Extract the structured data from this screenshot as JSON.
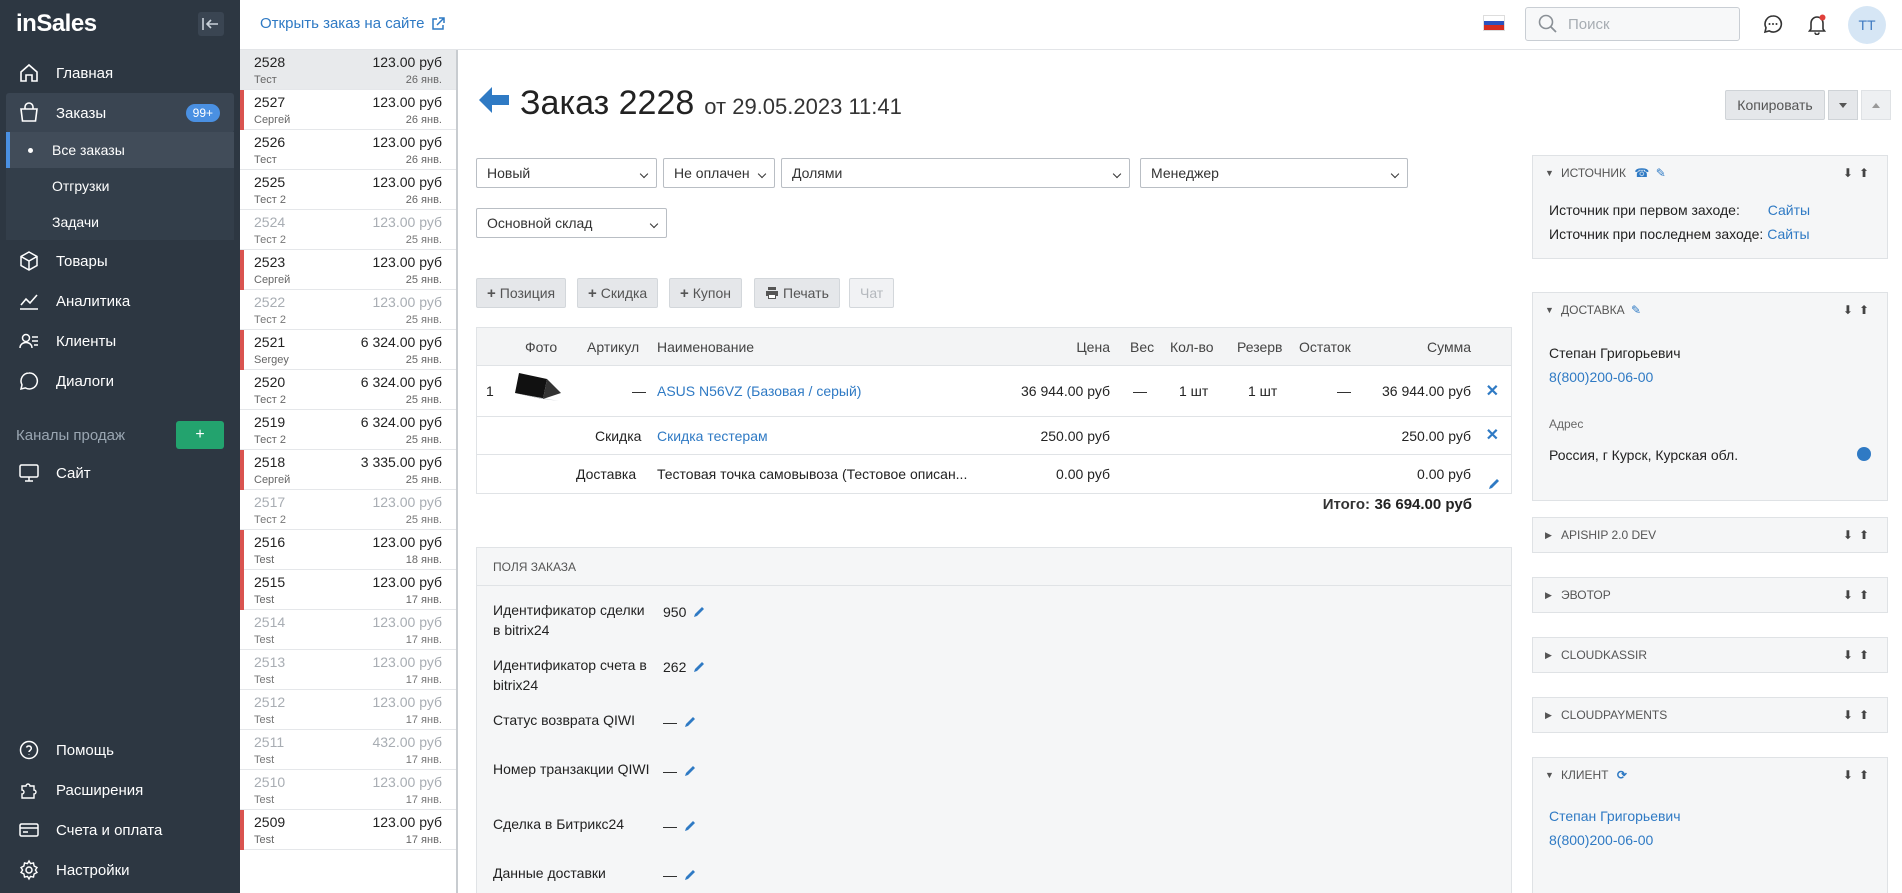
{
  "app": {
    "logo": "inSales"
  },
  "sidebar": {
    "nav": [
      {
        "label": "Главная",
        "icon": "home-icon"
      },
      {
        "label": "Заказы",
        "icon": "bag-icon",
        "badge": "99+"
      },
      {
        "label": "Товары",
        "icon": "box-icon"
      },
      {
        "label": "Аналитика",
        "icon": "chart-icon"
      },
      {
        "label": "Клиенты",
        "icon": "users-icon"
      },
      {
        "label": "Диалоги",
        "icon": "chat-icon"
      }
    ],
    "orders_sub": [
      "Все заказы",
      "Отгрузки",
      "Задачи"
    ],
    "channels_label": "Каналы продаж",
    "add_channel": "+",
    "site": "Сайт",
    "bottom": [
      "Помощь",
      "Расширения",
      "Счета и оплата",
      "Настройки"
    ]
  },
  "topbar": {
    "open_link": "Открыть заказ на сайте",
    "search_placeholder": "Поиск",
    "avatar": "TT"
  },
  "orders": [
    {
      "num": "2528",
      "sum": "123.00 руб",
      "who": "Тест",
      "date": "26 янв.",
      "state": "selected"
    },
    {
      "num": "2527",
      "sum": "123.00 руб",
      "who": "Сергей",
      "date": "26 янв.",
      "state": "marked"
    },
    {
      "num": "2526",
      "sum": "123.00 руб",
      "who": "Тест",
      "date": "26 янв.",
      "state": "normal"
    },
    {
      "num": "2525",
      "sum": "123.00 руб",
      "who": "Тест 2",
      "date": "26 янв.",
      "state": "normal"
    },
    {
      "num": "2524",
      "sum": "123.00 руб",
      "who": "Тест 2",
      "date": "25 янв.",
      "state": "dim"
    },
    {
      "num": "2523",
      "sum": "123.00 руб",
      "who": "Сергей",
      "date": "25 янв.",
      "state": "marked"
    },
    {
      "num": "2522",
      "sum": "123.00 руб",
      "who": "Тест 2",
      "date": "25 янв.",
      "state": "dim"
    },
    {
      "num": "2521",
      "sum": "6 324.00 руб",
      "who": "Sergey",
      "date": "25 янв.",
      "state": "marked"
    },
    {
      "num": "2520",
      "sum": "6 324.00 руб",
      "who": "Тест 2",
      "date": "25 янв.",
      "state": "normal"
    },
    {
      "num": "2519",
      "sum": "6 324.00 руб",
      "who": "Тест 2",
      "date": "25 янв.",
      "state": "normal"
    },
    {
      "num": "2518",
      "sum": "3 335.00 руб",
      "who": "Сергей",
      "date": "25 янв.",
      "state": "marked"
    },
    {
      "num": "2517",
      "sum": "123.00 руб",
      "who": "Тест 2",
      "date": "25 янв.",
      "state": "dim"
    },
    {
      "num": "2516",
      "sum": "123.00 руб",
      "who": "Test",
      "date": "18 янв.",
      "state": "marked"
    },
    {
      "num": "2515",
      "sum": "123.00 руб",
      "who": "Test",
      "date": "17 янв.",
      "state": "marked"
    },
    {
      "num": "2514",
      "sum": "123.00 руб",
      "who": "Test",
      "date": "17 янв.",
      "state": "dim"
    },
    {
      "num": "2513",
      "sum": "123.00 руб",
      "who": "Test",
      "date": "17 янв.",
      "state": "dim"
    },
    {
      "num": "2512",
      "sum": "123.00 руб",
      "who": "Test",
      "date": "17 янв.",
      "state": "dim"
    },
    {
      "num": "2511",
      "sum": "432.00 руб",
      "who": "Test",
      "date": "17 янв.",
      "state": "dim"
    },
    {
      "num": "2510",
      "sum": "123.00 руб",
      "who": "Test",
      "date": "17 янв.",
      "state": "dim"
    },
    {
      "num": "2509",
      "sum": "123.00 руб",
      "who": "Test",
      "date": "17 янв.",
      "state": "marked"
    }
  ],
  "order": {
    "title": "Заказ 2228",
    "date": "от 29.05.2023 11:41",
    "copy": "Копировать",
    "selects": {
      "status": "Новый",
      "payment": "Не оплачен",
      "method": "Долями",
      "manager": "Менеджер",
      "warehouse": "Основной склад"
    },
    "tools": [
      "Позиция",
      "Скидка",
      "Купон",
      "Печать",
      "Чат"
    ],
    "columns": {
      "photo": "Фото",
      "sku": "Артикул",
      "name": "Наименование",
      "price": "Цена",
      "weight": "Вес",
      "qty": "Кол-во",
      "reserve": "Резерв",
      "stock": "Остаток",
      "sum": "Сумма"
    },
    "item": {
      "n": "1",
      "sku": "—",
      "name": "ASUS N56VZ (Базовая / серый)",
      "price": "36 944.00 руб",
      "weight": "—",
      "qty": "1 шт",
      "reserve": "1 шт",
      "stock": "—",
      "sum": "36 944.00 руб"
    },
    "discount": {
      "label": "Скидка",
      "name": "Скидка тестерам",
      "price": "250.00 руб",
      "sum": "250.00 руб"
    },
    "delivery": {
      "label": "Доставка",
      "name": "Тестовая точка самовывоза (Тестовое описан...",
      "price": "0.00 руб",
      "sum": "0.00 руб"
    },
    "total_label": "Итого:",
    "total": "36 694.00 руб"
  },
  "fields": {
    "title": "Поля заказа",
    "rows": [
      {
        "label": "Идентификатор сделки в bitrix24",
        "value": "950"
      },
      {
        "label": "Идентификатор счета в bitrix24",
        "value": "262"
      },
      {
        "label": "Статус возврата QIWI",
        "value": "—"
      },
      {
        "label": "Номер транзакции QIWI",
        "value": "—"
      },
      {
        "label": "Сделка в Битрикс24",
        "value": "—"
      },
      {
        "label": "Данные доставки",
        "value": "—"
      }
    ]
  },
  "panels": {
    "source": {
      "title": "Источник",
      "first_label": "Источник при первом заходе:",
      "first_value": "Сайты",
      "last_label": "Источник при последнем заходе:",
      "last_value": "Сайты"
    },
    "delivery": {
      "title": "Доставка",
      "name": "Степан Григорьевич",
      "phone": "8(800)200-06-00",
      "address_label": "Адрес",
      "address": "Россия, г Курск, Курская обл."
    },
    "collapsed": [
      "Apiship 2.0 dev",
      "Эвотор",
      "CloudKassir",
      "CloudPayments"
    ],
    "client": {
      "title": "Клиент",
      "name": "Степан Григорьевич",
      "phone": "8(800)200-06-00"
    }
  }
}
